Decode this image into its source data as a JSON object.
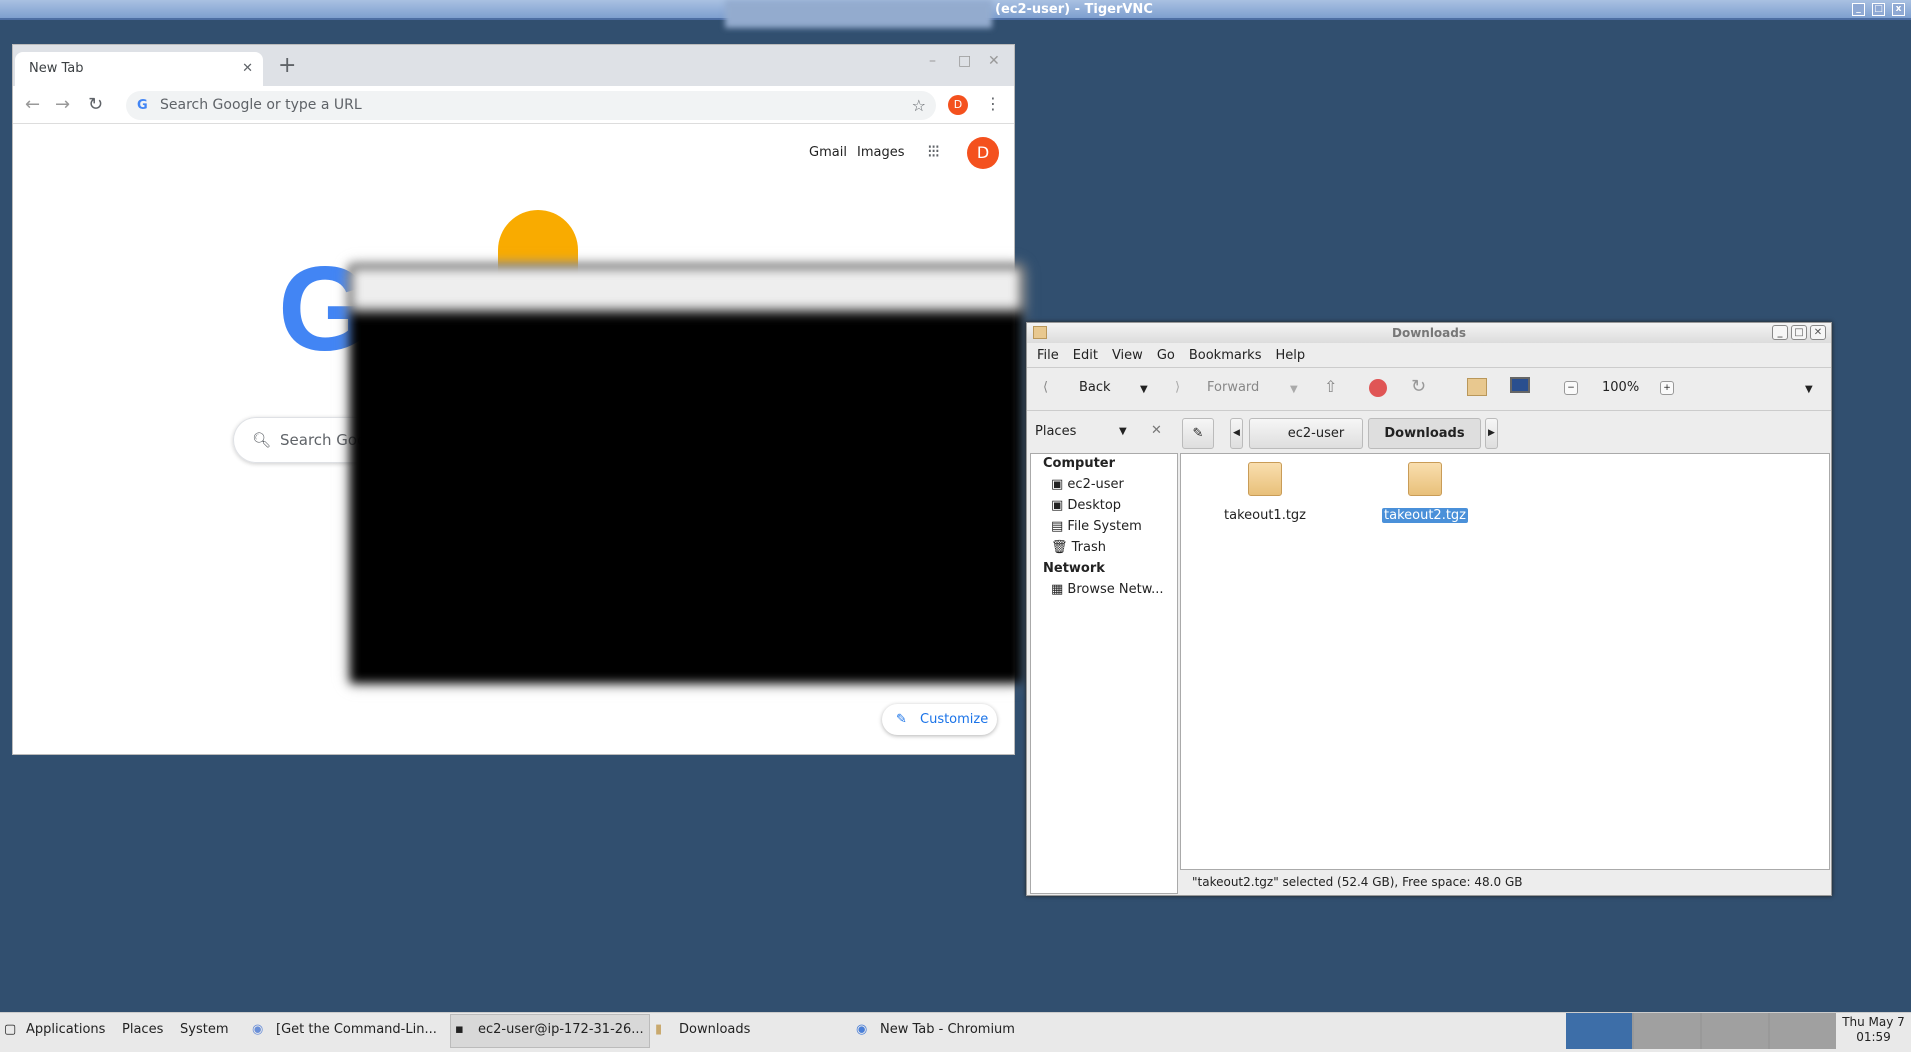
{
  "vnc": {
    "title": "(ec2-user) - TigerVNC"
  },
  "chrome": {
    "tab_title": "New Tab",
    "new_tab": "+",
    "omnibox_placeholder": "Search Google or type a URL",
    "profile_initial": "D",
    "gmail": "Gmail",
    "images": "Images",
    "logo": "G",
    "search_placeholder": "Search Google or type a URL",
    "customize": "Customize"
  },
  "nautilus": {
    "title": "Downloads",
    "menu": [
      "File",
      "Edit",
      "View",
      "Go",
      "Bookmarks",
      "Help"
    ],
    "toolbar": {
      "back": "Back",
      "forward": "Forward",
      "zoom": "100%"
    },
    "places_label": "Places",
    "breadcrumb": [
      "ec2-user",
      "Downloads"
    ],
    "sidebar": {
      "computer": "Computer",
      "items": [
        "ec2-user",
        "Desktop",
        "File System",
        "Trash"
      ],
      "network": "Network",
      "network_items": [
        "Browse Netw..."
      ]
    },
    "files": [
      {
        "name": "takeout1.tgz",
        "selected": false
      },
      {
        "name": "takeout2.tgz",
        "selected": true
      }
    ],
    "status": "\"takeout2.tgz\" selected (52.4 GB), Free space: 48.0 GB"
  },
  "taskbar": {
    "applications": "Applications",
    "places": "Places",
    "system": "System",
    "tasks": [
      "[Get the Command-Lin...",
      "ec2-user@ip-172-31-26...",
      "Downloads",
      "New Tab - Chromium"
    ],
    "clock_day": "Thu May  7",
    "clock_time": "01:59"
  }
}
